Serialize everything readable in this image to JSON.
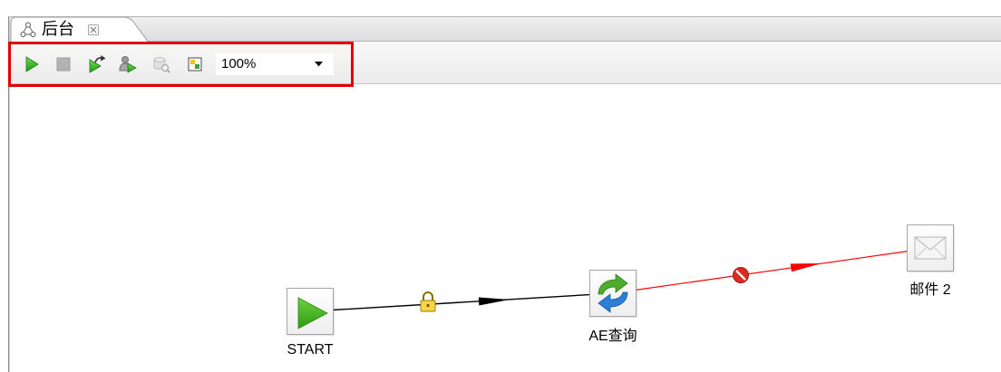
{
  "tab": {
    "title": "后台",
    "icon": "job-icon",
    "close_icon": "close-icon"
  },
  "toolbar": {
    "buttons": [
      {
        "icon": "run-icon",
        "enabled": true
      },
      {
        "icon": "stop-icon",
        "enabled": false
      },
      {
        "icon": "replay-icon",
        "enabled": true
      },
      {
        "icon": "job-check-icon",
        "enabled": true
      },
      {
        "icon": "explore-database-icon",
        "enabled": false
      },
      {
        "icon": "show-results-icon",
        "enabled": true
      }
    ],
    "zoom": {
      "value": "100%",
      "icon": "chevron-down-icon"
    }
  },
  "canvas": {
    "nodes": [
      {
        "label": "START",
        "icon": "start-icon"
      },
      {
        "label": "AE查询",
        "icon": "transformation-icon"
      },
      {
        "label": "邮件 2",
        "icon": "mail-icon"
      }
    ],
    "hops": [
      {
        "color": "#000000",
        "icon": "lock-icon"
      },
      {
        "color": "#ff0000",
        "icon": "error-icon"
      }
    ]
  },
  "annotation": {
    "highlight_color": "#e00000"
  }
}
